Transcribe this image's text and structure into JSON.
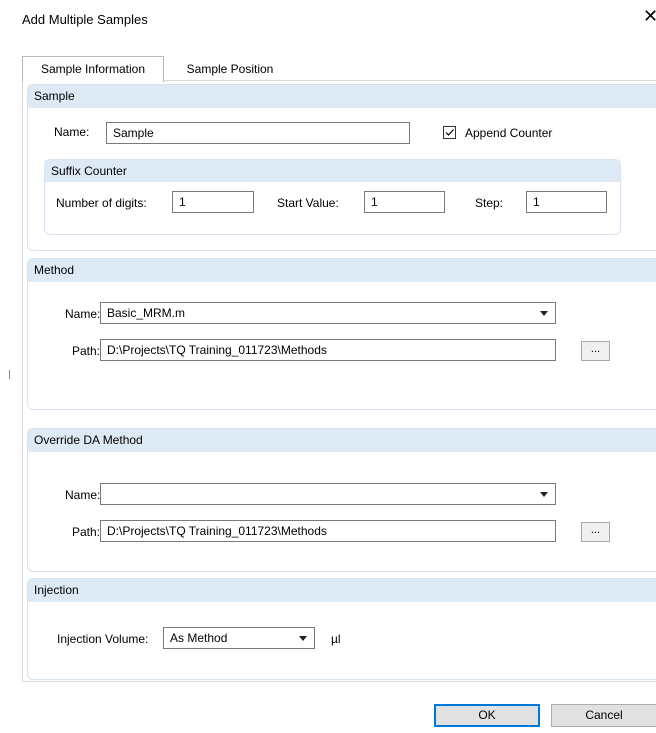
{
  "window": {
    "title": "Add Multiple Samples",
    "close_glyph": "✕"
  },
  "tabs": [
    {
      "label": "Sample Information",
      "active": true
    },
    {
      "label": "Sample Position",
      "active": false
    }
  ],
  "sample": {
    "header": "Sample",
    "name_label": "Name:",
    "name_value": "Sample",
    "append_counter_label": "Append Counter",
    "append_counter_checked": true,
    "suffix": {
      "header": "Suffix Counter",
      "digits_label": "Number of digits:",
      "digits_value": "1",
      "start_label": "Start Value:",
      "start_value": "1",
      "step_label": "Step:",
      "step_value": "1"
    }
  },
  "method": {
    "header": "Method",
    "name_label": "Name:",
    "name_value": "Basic_MRM.m",
    "path_label": "Path:",
    "path_value": "D:\\Projects\\TQ Training_011723\\Methods",
    "browse_label": "..."
  },
  "override": {
    "header": "Override DA Method",
    "name_label": "Name:",
    "name_value": "",
    "path_label": "Path:",
    "path_value": "D:\\Projects\\TQ Training_011723\\Methods",
    "browse_label": "..."
  },
  "injection": {
    "header": "Injection",
    "volume_label": "Injection Volume:",
    "volume_value": "As Method",
    "unit": "µl"
  },
  "buttons": {
    "ok": "OK",
    "cancel": "Cancel"
  },
  "colors": {
    "section_header_bg": "#dde9f4",
    "section_border": "#d7e4ef",
    "default_button_border": "#0078d7"
  }
}
